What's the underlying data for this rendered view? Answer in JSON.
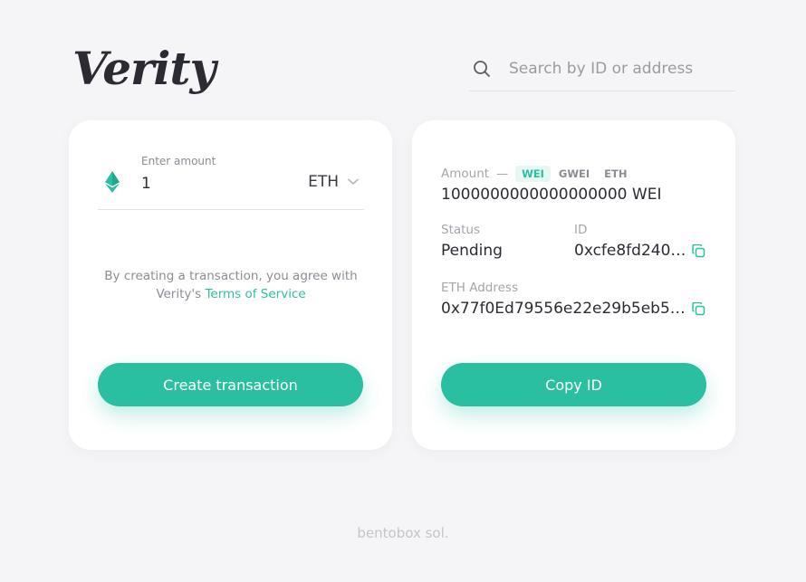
{
  "brand": {
    "name": "Verity"
  },
  "search": {
    "placeholder": "Search by ID or address",
    "icon": "search-icon"
  },
  "create_card": {
    "amount_label": "Enter amount",
    "amount_value": "1",
    "currency": "ETH",
    "terms_text": "By creating a transaction, you agree with",
    "terms_prefix": "Verity's",
    "terms_link": "Terms of Service",
    "button_label": "Create transaction"
  },
  "detail_card": {
    "amount_label": "Amount",
    "amount_dash": "—",
    "units": [
      {
        "label": "WEI",
        "active": true
      },
      {
        "label": "GWEI",
        "active": false
      },
      {
        "label": "ETH",
        "active": false
      }
    ],
    "amount_value": "1000000000000000000 WEI",
    "status_label": "Status",
    "status_value": "Pending",
    "id_label": "ID",
    "id_value": "0xcfe8fd2407…",
    "address_label": "ETH Address",
    "address_value": "0x77f0Ed79556e22e29b5eb5fe…",
    "button_label": "Copy ID"
  },
  "footer": {
    "text": "bentobox sol."
  },
  "colors": {
    "accent": "#2bbfa2",
    "background": "#f5f5f7",
    "card": "#ffffff",
    "text": "#2b2b33"
  }
}
